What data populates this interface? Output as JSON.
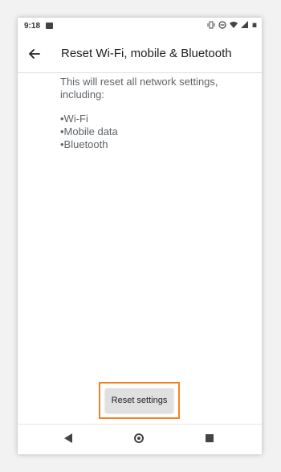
{
  "status_bar": {
    "time": "9:18",
    "icons": [
      "image-icon",
      "vibrate-icon",
      "do-not-disturb-icon",
      "wifi-icon",
      "signal-icon",
      "battery-icon"
    ]
  },
  "app_bar": {
    "title": "Reset Wi-Fi, mobile & Bluetooth",
    "back_icon": "arrow-back-icon"
  },
  "content": {
    "description": "This will reset all network settings, including:",
    "items": [
      "•Wi-Fi",
      "•Mobile data",
      "•Bluetooth"
    ]
  },
  "reset_button": {
    "label": "Reset settings",
    "highlight_color": "#f58220"
  },
  "nav_bar": {
    "icons": [
      "nav-back-icon",
      "nav-home-icon",
      "nav-recents-icon"
    ]
  }
}
